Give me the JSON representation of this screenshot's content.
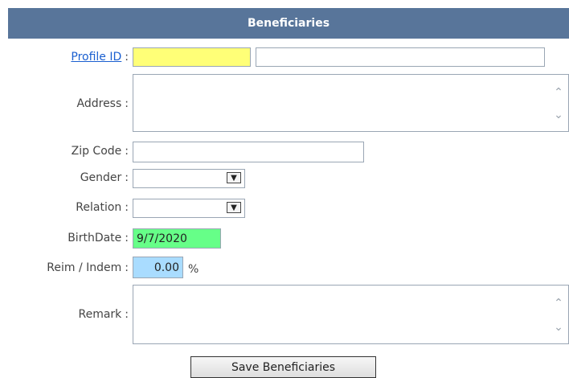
{
  "header": {
    "title": "Beneficiaries"
  },
  "form": {
    "profile_id": {
      "label": "Profile ID",
      "value": "",
      "name_value": "",
      "color": "#ffff77"
    },
    "address": {
      "label": "Address",
      "value": ""
    },
    "zip": {
      "label": "Zip Code",
      "value": ""
    },
    "gender": {
      "label": "Gender",
      "selected": ""
    },
    "relation": {
      "label": "Relation",
      "selected": ""
    },
    "birthdate": {
      "label": "BirthDate",
      "value": "9/7/2020",
      "color": "#66ff88"
    },
    "reim": {
      "label": "Reim / Indem",
      "value": "0.00",
      "unit": "%",
      "color": "#a9dcff"
    },
    "remark": {
      "label": "Remark",
      "value": ""
    }
  },
  "actions": {
    "save_label": "Save Beneficiaries"
  },
  "icons": {
    "scroll_up": "chevron-up-icon",
    "scroll_down": "chevron-down-icon",
    "dropdown": "dropdown-arrow-icon"
  }
}
